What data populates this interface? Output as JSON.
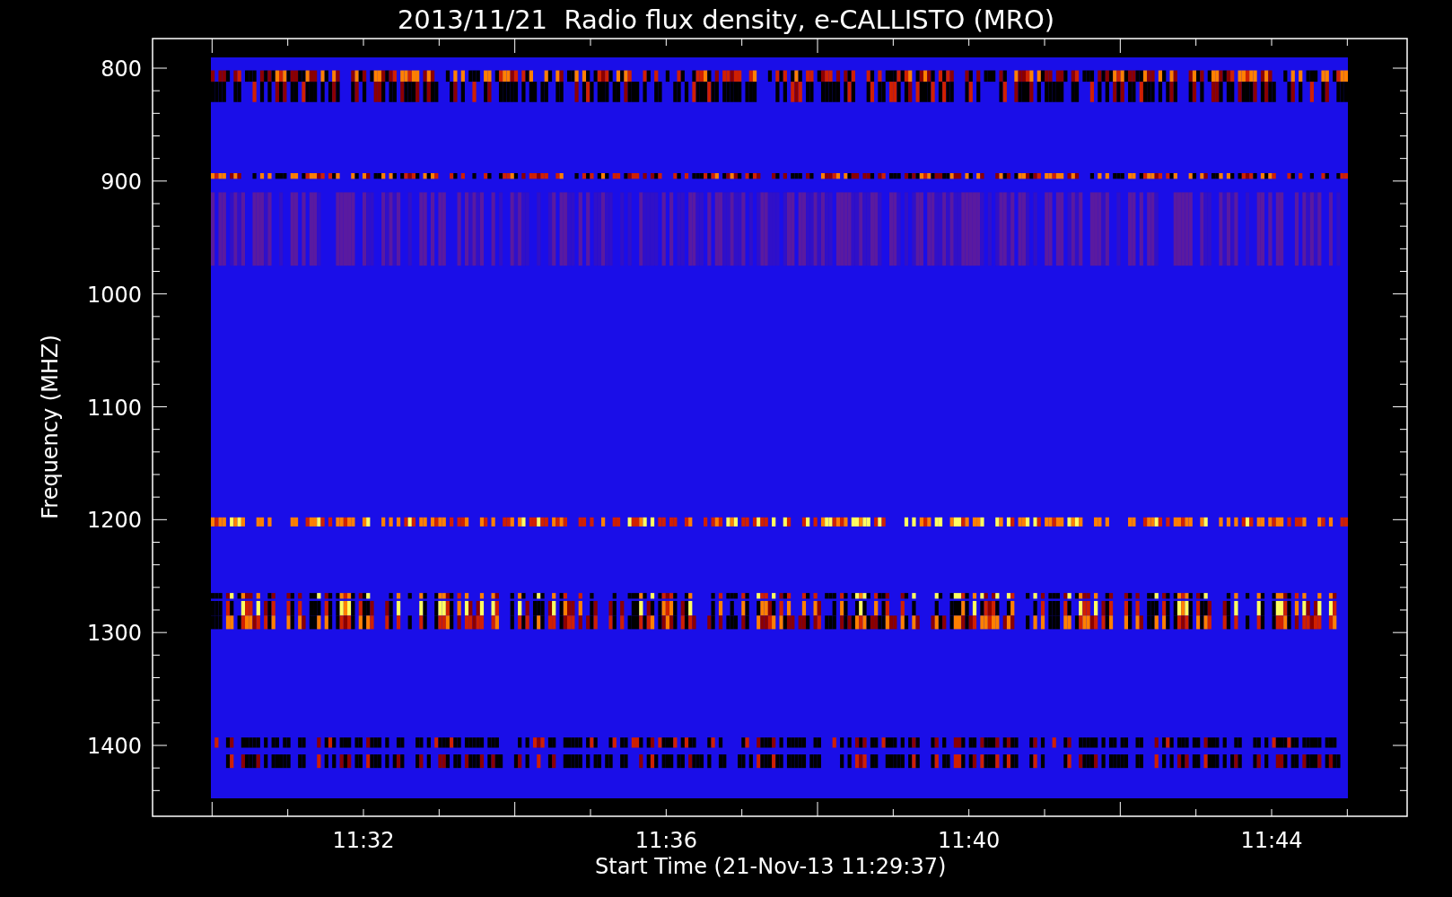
{
  "title": "2013/11/21  Radio flux density, e-CALLISTO (MRO)",
  "y_axis": {
    "label": "Frequency (MHZ)",
    "ticks": [
      "800",
      "900",
      "1000",
      "1100",
      "1200",
      "1300",
      "1400"
    ]
  },
  "x_axis": {
    "label": "Start Time (21-Nov-13 11:29:37)",
    "ticks": [
      "11:32",
      "11:36",
      "11:40",
      "11:44"
    ]
  }
}
